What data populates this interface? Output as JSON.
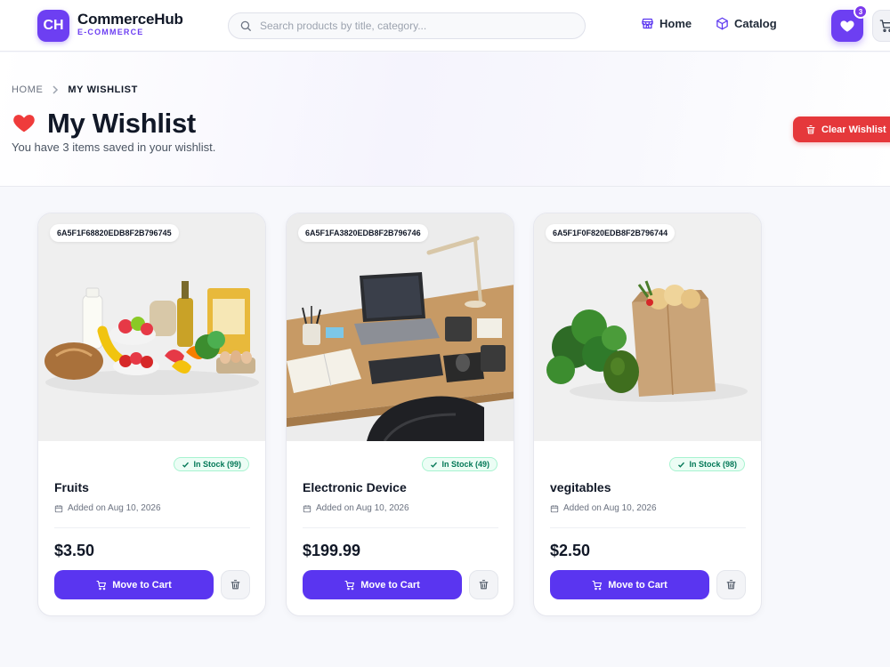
{
  "brand": {
    "logo_initials": "CH",
    "name": "CommerceHub",
    "tagline": "E-COMMERCE"
  },
  "search": {
    "placeholder": "Search products by title, category..."
  },
  "nav": {
    "home_label": "Home",
    "catalog_label": "Catalog"
  },
  "wishlist_badge_count": "3",
  "breadcrumb": {
    "home": "HOME",
    "current": "MY WISHLIST"
  },
  "page": {
    "title": "My Wishlist",
    "subtitle": "You have 3 items saved in your wishlist.",
    "clear_label": "Clear Wishlist"
  },
  "items": [
    {
      "id": "6A5F1F68820EDB8F2B796745",
      "stock": "In Stock (99)",
      "name": "Fruits",
      "added": "Added on Aug 10, 2026",
      "price": "$3.50",
      "move_label": "Move to Cart"
    },
    {
      "id": "6A5F1FA3820EDB8F2B796746",
      "stock": "In Stock (49)",
      "name": "Electronic Device",
      "added": "Added on Aug 10, 2026",
      "price": "$199.99",
      "move_label": "Move to Cart"
    },
    {
      "id": "6A5F1F0F820EDB8F2B796744",
      "stock": "In Stock (98)",
      "name": "vegitables",
      "added": "Added on Aug 10, 2026",
      "price": "$2.50",
      "move_label": "Move to Cart"
    }
  ],
  "colors": {
    "brand": "#6d3ff2",
    "primary_button": "#5a35f0",
    "danger": "#e5383b",
    "stock_green": "#047857"
  }
}
